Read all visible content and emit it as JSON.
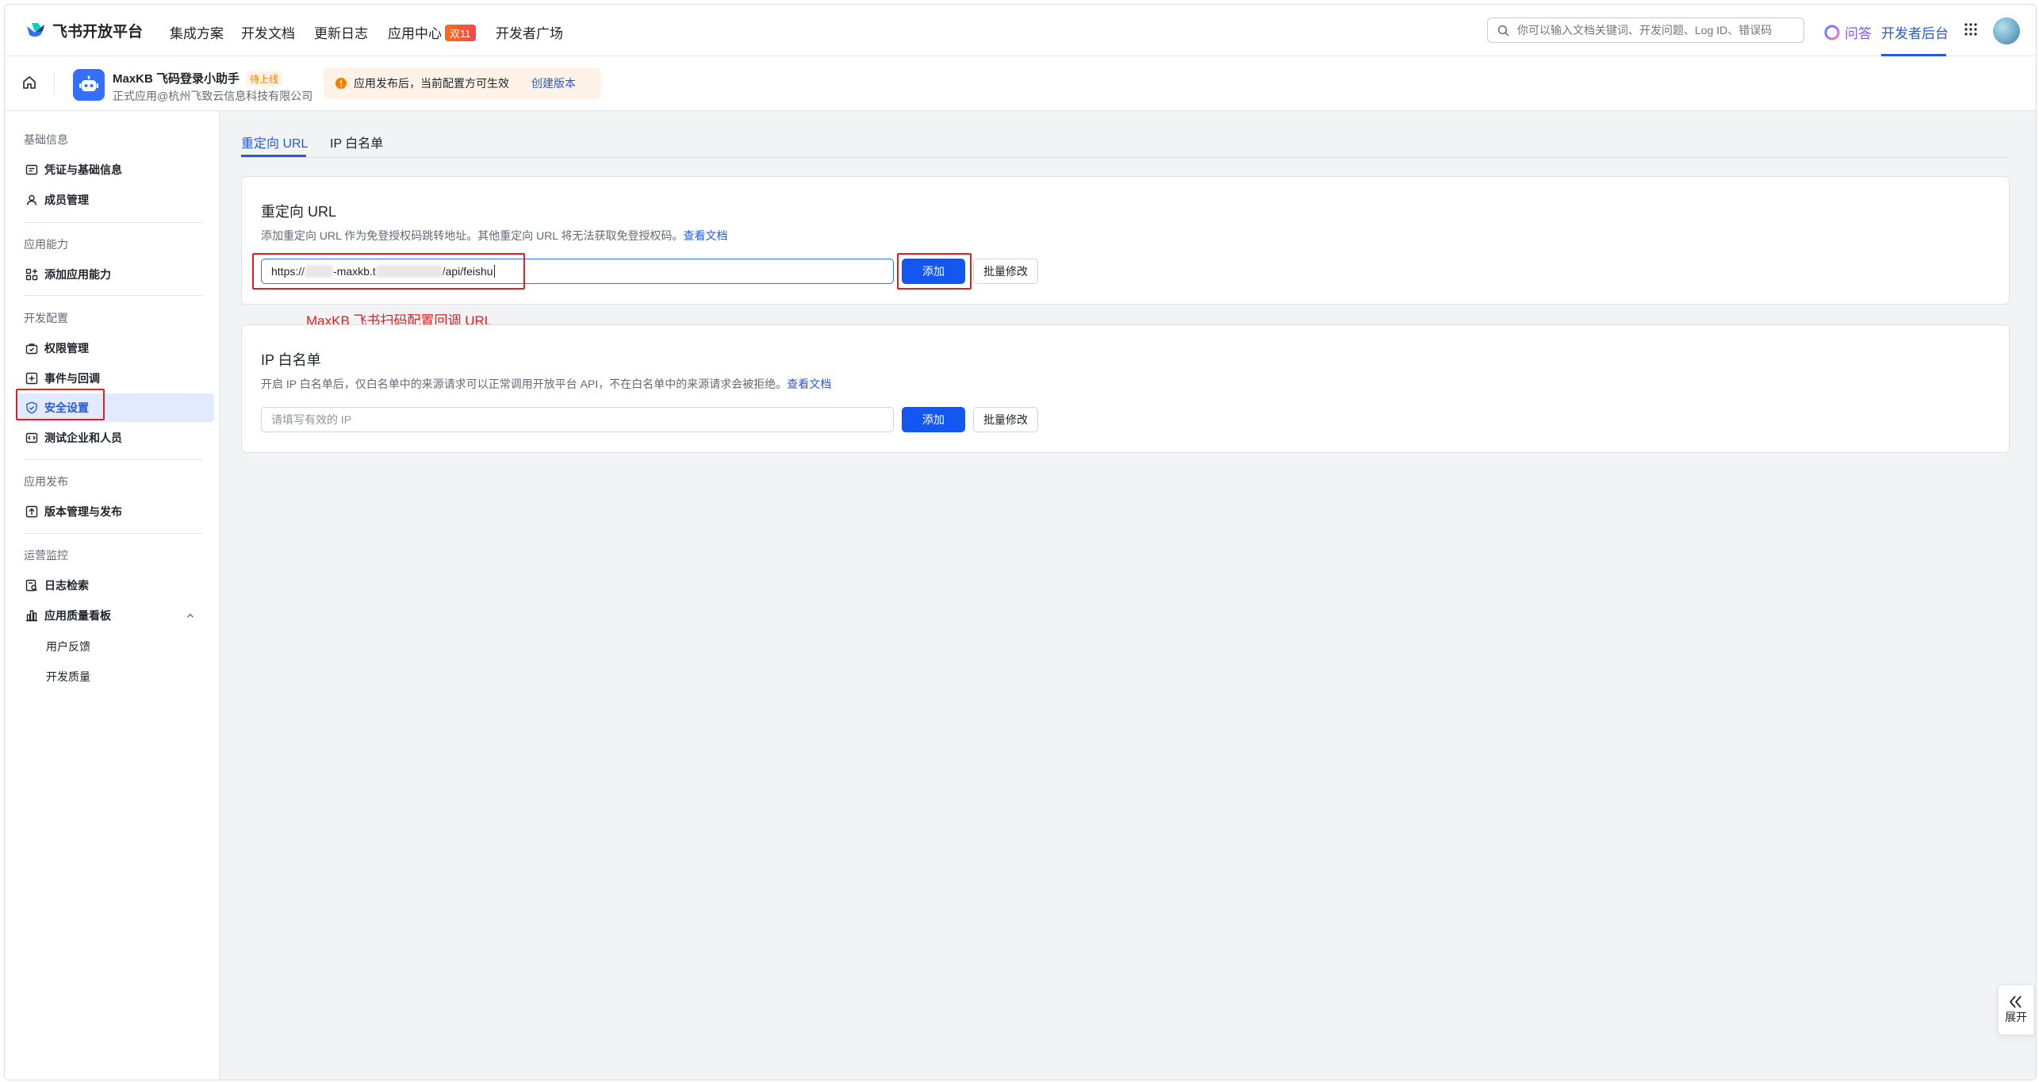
{
  "topnav": {
    "logo_text": "飞书开放平台",
    "items": [
      {
        "label": "集成方案"
      },
      {
        "label": "开发文档"
      },
      {
        "label": "更新日志"
      },
      {
        "label": "应用中心",
        "badge": "双11"
      },
      {
        "label": "开发者广场"
      }
    ],
    "search_placeholder": "你可以输入文档关键词、开发问题、Log ID、错误码",
    "qa_label": "问答",
    "dev_console_label": "开发者后台"
  },
  "subheader": {
    "app_name": "MaxKB 飞码登录小助手",
    "app_status": "待上线",
    "app_org": "正式应用@杭州飞致云信息科技有限公司",
    "notice_text": "应用发布后，当前配置方可生效",
    "notice_link": "创建版本"
  },
  "sidebar": {
    "groups": [
      {
        "title": "基础信息",
        "items": [
          "凭证与基础信息",
          "成员管理"
        ]
      },
      {
        "title": "应用能力",
        "items": [
          "添加应用能力"
        ]
      },
      {
        "title": "开发配置",
        "items": [
          "权限管理",
          "事件与回调",
          "安全设置",
          "测试企业和人员"
        ]
      },
      {
        "title": "应用发布",
        "items": [
          "版本管理与发布"
        ]
      },
      {
        "title": "运营监控",
        "items": [
          "日志检索",
          "应用质量看板"
        ],
        "subitems": [
          "用户反馈",
          "开发质量"
        ]
      }
    ],
    "active_item": "安全设置"
  },
  "main": {
    "tabs": [
      {
        "label": "重定向 URL"
      },
      {
        "label": "IP 白名单"
      }
    ],
    "redirect": {
      "title": "重定向 URL",
      "desc": "添加重定向 URL 作为免登授权码跳转地址。其他重定向 URL 将无法获取免登授权码。",
      "doc_link": "查看文档",
      "url_prefix": "https://",
      "url_mid": "-maxkb.t",
      "url_suffix": "/api/feishu",
      "add_label": "添加",
      "batch_label": "批量修改"
    },
    "annotation": "MaxKB 飞书扫码配置回调 URL",
    "ipwhitelist": {
      "title": "IP 白名单",
      "desc": "开启 IP 白名单后，仅白名单中的来源请求可以正常调用开放平台 API，不在白名单中的来源请求会被拒绝。",
      "doc_link": "查看文档",
      "placeholder": "请填写有效的 IP",
      "add_label": "添加",
      "batch_label": "批量修改"
    },
    "expand_label": "展开"
  }
}
